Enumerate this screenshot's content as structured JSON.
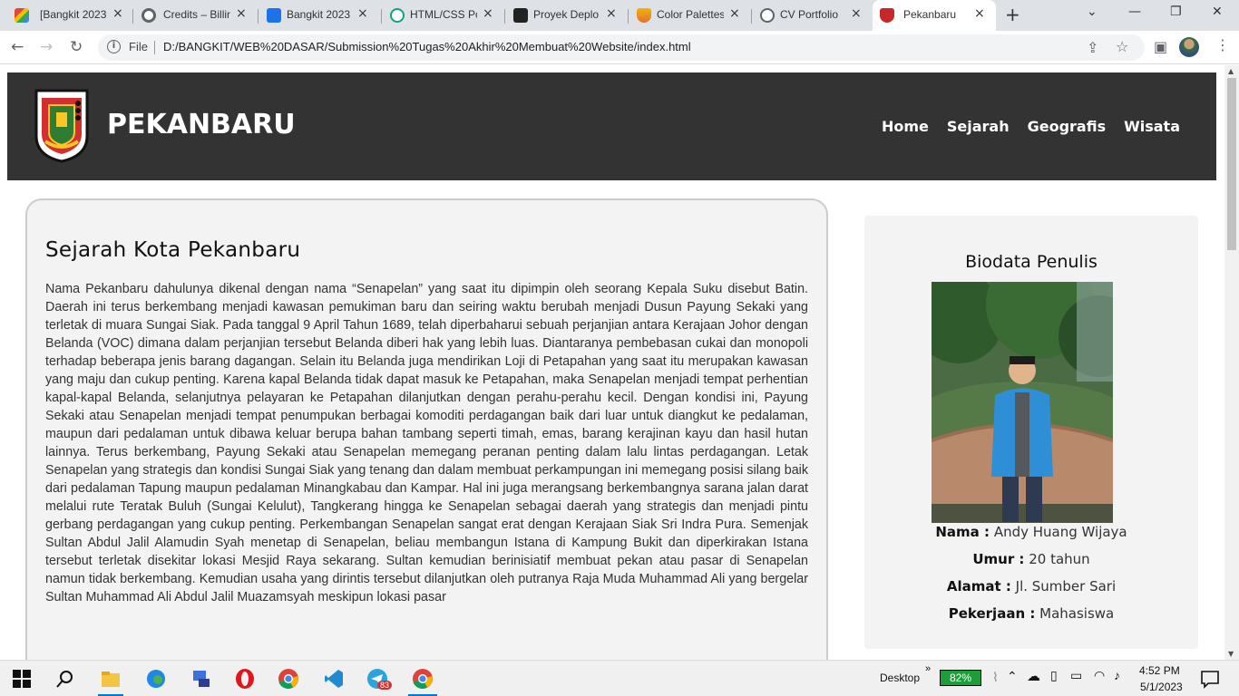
{
  "browser": {
    "tabs": [
      {
        "title": "[Bangkit 2023",
        "close": "×"
      },
      {
        "title": "Credits – Billin",
        "close": "×"
      },
      {
        "title": "Bangkit 2023",
        "close": "×"
      },
      {
        "title": "HTML/CSS Po",
        "close": "×"
      },
      {
        "title": "Proyek Deplo",
        "close": "×"
      },
      {
        "title": "Color Palettes",
        "close": "×"
      },
      {
        "title": "CV Portfolio",
        "close": "×"
      },
      {
        "title": "Pekanbaru",
        "close": "×"
      }
    ],
    "new_tab": "+",
    "file_label": "File",
    "url": "D:/BANGKIT/WEB%20DASAR/Submission%20Tugas%20Akhir%20Membuat%20Website/index.html"
  },
  "site": {
    "brand": "PEKANBARU",
    "logo_text": "PEKANBARU",
    "nav": [
      "Home",
      "Sejarah",
      "Geografis",
      "Wisata"
    ]
  },
  "article": {
    "title": "Sejarah Kota Pekanbaru",
    "body": "Nama Pekanbaru dahulunya dikenal dengan nama “Senapelan” yang saat itu dipimpin oleh seorang Kepala Suku disebut Batin. Daerah ini terus berkembang menjadi kawasan pemukiman baru dan seiring waktu berubah menjadi Dusun Payung Sekaki yang terletak di muara Sungai Siak. Pada tanggal 9 April Tahun 1689, telah diperbaharui sebuah perjanjian antara Kerajaan Johor dengan Belanda (VOC) dimana dalam perjanjian tersebut Belanda diberi hak yang lebih luas. Diantaranya pembebasan cukai dan monopoli terhadap beberapa jenis barang dagangan. Selain itu Belanda juga mendirikan Loji di Petapahan yang saat itu merupakan kawasan yang maju dan cukup penting. Karena kapal Belanda tidak dapat masuk ke Petapahan, maka Senapelan menjadi tempat perhentian kapal-kapal Belanda, selanjutnya pelayaran ke Petapahan dilanjutkan dengan perahu-perahu kecil. Dengan kondisi ini, Payung Sekaki atau Senapelan menjadi tempat penumpukan berbagai komoditi perdagangan baik dari luar untuk diangkut ke pedalaman, maupun dari pedalaman untuk dibawa keluar berupa bahan tambang seperti timah, emas, barang kerajinan kayu dan hasil hutan lainnya. Terus berkembang, Payung Sekaki atau Senapelan memegang peranan penting dalam lalu lintas perdagangan. Letak Senapelan yang strategis dan kondisi Sungai Siak yang tenang dan dalam membuat perkampungan ini memegang posisi silang baik dari pedalaman Tapung maupun pedalaman Minangkabau dan Kampar. Hal ini juga merangsang berkembangnya sarana jalan darat melalui rute Teratak Buluh (Sungai Kelulut), Tangkerang hingga ke Senapelan sebagai daerah yang strategis dan menjadi pintu gerbang perdagangan yang cukup penting. Perkembangan Senapelan sangat erat dengan Kerajaan Siak Sri Indra Pura. Semenjak Sultan Abdul Jalil Alamudin Syah menetap di Senapelan, beliau membangun Istana di Kampung Bukit dan diperkirakan Istana tersebut terletak disekitar lokasi Mesjid Raya sekarang. Sultan kemudian berinisiatif membuat pekan atau pasar di Senapelan namun tidak berkembang. Kemudian usaha yang dirintis tersebut dilanjutkan oleh putranya Raja Muda Muhammad Ali yang bergelar Sultan Muhammad Ali Abdul Jalil Muazamsyah meskipun lokasi pasar"
  },
  "sidebar": {
    "title": "Biodata Penulis",
    "fields": [
      {
        "label": "Nama :",
        "value": "Andy Huang Wijaya"
      },
      {
        "label": "Umur :",
        "value": "20 tahun"
      },
      {
        "label": "Alamat :",
        "value": "Jl. Sumber Sari"
      },
      {
        "label": "Pekerjaan :",
        "value": "Mahasiswa"
      }
    ]
  },
  "taskbar": {
    "desktop_label": "Desktop",
    "battery": "82%",
    "time": "4:52 PM",
    "date": "5/1/2023",
    "telegram_badge": "83",
    "chevron": "»"
  },
  "colors": {
    "header_bg": "#333333",
    "card_bg": "#f3f3f3",
    "battery_green": "#1e9e3a"
  }
}
